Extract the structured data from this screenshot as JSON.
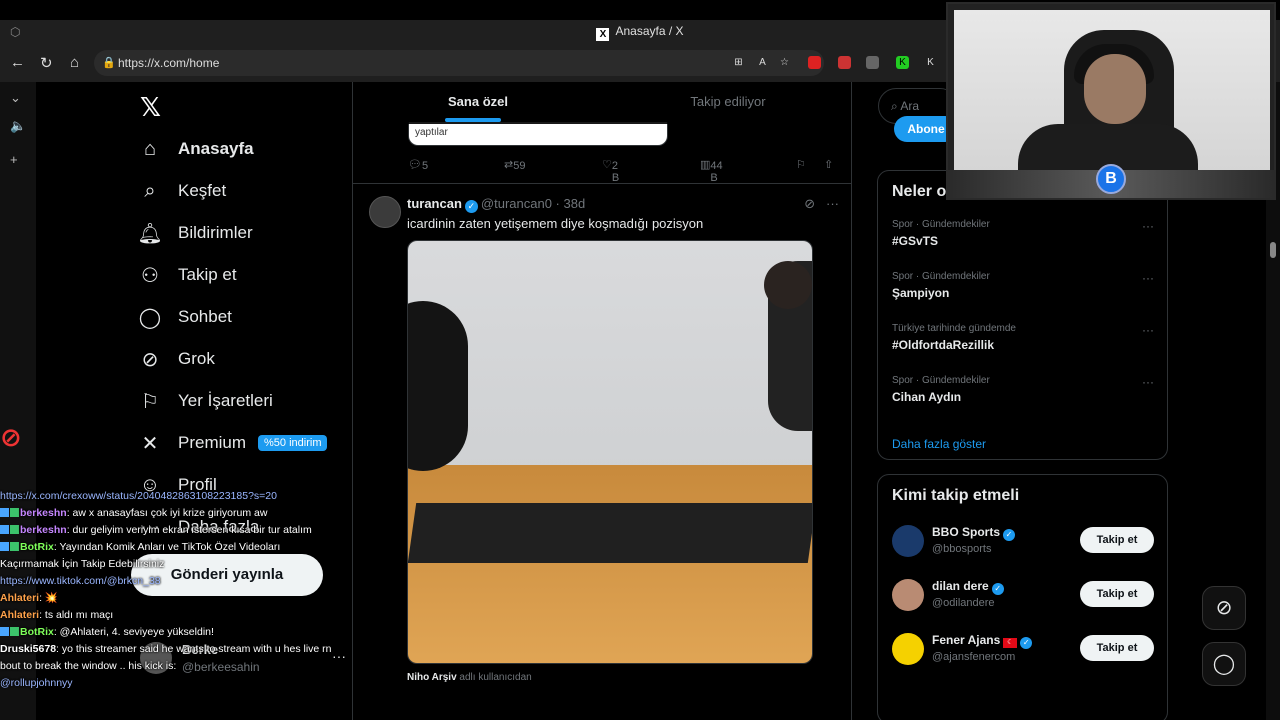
{
  "browser": {
    "tab_title": "Anasayfa / X",
    "url": "https://x.com/home"
  },
  "nav": {
    "items": [
      {
        "label": "Anasayfa",
        "icon": "home-icon"
      },
      {
        "label": "Keşfet",
        "icon": "search-icon"
      },
      {
        "label": "Bildirimler",
        "icon": "bell-icon"
      },
      {
        "label": "Takip et",
        "icon": "follow-icon"
      },
      {
        "label": "Sohbet",
        "icon": "chat-icon"
      },
      {
        "label": "Grok",
        "icon": "grok-icon"
      },
      {
        "label": "Yer İşaretleri",
        "icon": "bookmark-icon"
      },
      {
        "label": "Premium",
        "icon": "premium-icon"
      },
      {
        "label": "Profil",
        "icon": "profile-icon"
      },
      {
        "label": "Daha fazla",
        "icon": "more-icon"
      }
    ],
    "premium_badge": "%50 indirim",
    "post_button": "Gönderi yayınla",
    "account_name": "Berke",
    "account_handle": "@berkeesahin"
  },
  "timeline": {
    "tabs": [
      "Sana özel",
      "Takip ediliyor"
    ],
    "prev_quote_text": "yaptılar",
    "prev_actions": {
      "replies": "5",
      "reposts": "59",
      "likes": "2 B",
      "views": "44 B"
    },
    "tweet": {
      "name": "turancan",
      "handle": "@turancan0",
      "time": "38d",
      "text": "icardinin zaten yetişemem diye koşmadığı pozisyon",
      "source_name": "Niho Arşiv",
      "source_suffix": "adlı kullanıcıdan"
    }
  },
  "right": {
    "search_placeholder": "Ara",
    "subscribe_button": "Abone",
    "trends_title": "Neler oluyor",
    "trends": [
      {
        "context": "Spor · Gündemdekiler",
        "title": "#GSvTS"
      },
      {
        "context": "Spor · Gündemdekiler",
        "title": "Şampiyon"
      },
      {
        "context": "Türkiye tarihinde gündemde",
        "title": "#OldfortdaRezillik"
      },
      {
        "context": "Spor · Gündemdekiler",
        "title": "Cihan Aydın"
      }
    ],
    "show_more": "Daha fazla göster",
    "follow_title": "Kimi takip etmeli",
    "follow": [
      {
        "name": "BBO Sports",
        "handle": "@bbosports",
        "button": "Takip et",
        "color": "#1a3a6b"
      },
      {
        "name": "dilan dere",
        "handle": "@odilandere",
        "button": "Takip et",
        "color": "#b98b73"
      },
      {
        "name": "Fener Ajans",
        "handle": "@ajansfenercom",
        "button": "Takip et",
        "color": "#f5d100"
      }
    ]
  },
  "chat": {
    "top_link": "https://x.com/crexoww/status/2040482863108223185?s=20",
    "messages": [
      {
        "user": "berkeshn",
        "cls": "u1",
        "text": ": aw x anasayfası çok iyi krize giriyorum aw"
      },
      {
        "user": "berkeshn",
        "cls": "u1",
        "text": ": dur geliyim veriyim ekran istersen kısa bir tur atalım"
      },
      {
        "user": "BotRix",
        "cls": "u2",
        "text": ": Yayından Komik Anları ve TikTok Özel Videoları Kaçırmamak İçin Takip Edebilirsiniz"
      },
      {
        "user": "",
        "cls": "link",
        "text": "https://www.tiktok.com/@brkcn_38"
      },
      {
        "user": "Ahlateri",
        "cls": "u3",
        "text": ": 💥"
      },
      {
        "user": "Ahlateri",
        "cls": "u3",
        "text": ": ts aldı mı maçı"
      },
      {
        "user": "BotRix",
        "cls": "u2",
        "text": ": @Ahlateri, 4. seviyeye yükseldin!"
      },
      {
        "user": "Druski5678",
        "cls": "u4",
        "text": ": yo this streamer said he wants to stream with u hes live rn bout to break the window .. his kick is:"
      },
      {
        "user": "",
        "cls": "link",
        "text": "@rollupjohnnyy"
      }
    ]
  }
}
